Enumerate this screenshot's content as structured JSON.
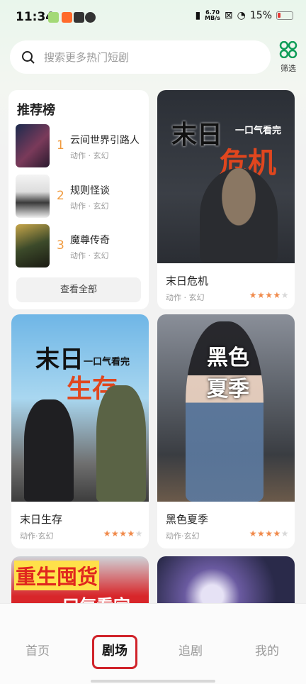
{
  "status_bar": {
    "time": "11:34",
    "net_speed_value": "6.70",
    "net_speed_unit": "MB/s",
    "battery": "15%"
  },
  "search": {
    "placeholder": "搜索更多热门短剧"
  },
  "filter": {
    "label": "筛选"
  },
  "ranking": {
    "title": "推荐榜",
    "items": [
      {
        "rank": "1",
        "name": "云间世界引路人",
        "tags": "动作 · 玄幻"
      },
      {
        "rank": "2",
        "name": "规则怪谈",
        "tags": "动作 · 玄幻"
      },
      {
        "rank": "3",
        "name": "魔尊传奇",
        "tags": "动作 · 玄幻"
      }
    ],
    "view_all": "查看全部"
  },
  "cards": [
    {
      "title": "末日危机",
      "tags": "动作 · 玄幻",
      "rating": 4,
      "poster_text_1": "末日",
      "poster_text_2": "危机",
      "poster_slogan": "一口气看完"
    },
    {
      "title": "末日生存",
      "tags": "动作·玄幻",
      "rating": 4,
      "poster_text_1": "末日",
      "poster_text_2": "生存",
      "poster_slogan": "一口气看完"
    },
    {
      "title": "黑色夏季",
      "tags": "动作·玄幻",
      "rating": 4,
      "poster_text": "黑色夏季"
    },
    {
      "poster_text": "重生囤货",
      "poster_slogan": "一口气看完"
    },
    {}
  ],
  "nav": {
    "home": "首页",
    "theater": "剧场",
    "follow": "追剧",
    "mine": "我的"
  },
  "colors": {
    "accent": "#f09a3e",
    "star": "#f08a4b",
    "nav_highlight": "#d0232a"
  }
}
